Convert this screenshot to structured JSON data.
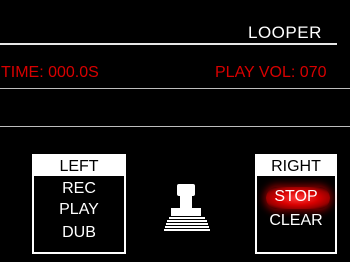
{
  "header": {
    "title": "LOOPER"
  },
  "status": {
    "time": "TIME: 000.0S",
    "play_vol": "PLAY VOL: 070"
  },
  "left_panel": {
    "label": "LEFT",
    "options": [
      "REC",
      "PLAY",
      "DUB"
    ]
  },
  "right_panel": {
    "label": "RIGHT",
    "options": [
      "STOP",
      "CLEAR"
    ],
    "selected_option": "STOP"
  },
  "colors": {
    "background": "#000000",
    "text": "#ffffff",
    "accent": "#d80000"
  },
  "icons": {
    "center": "foot-pedal-icon"
  }
}
